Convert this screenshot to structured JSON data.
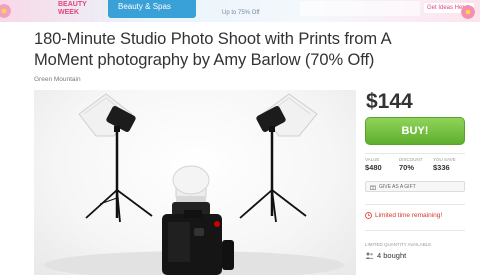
{
  "banner": {
    "left_text": "BEAUTY\nWEEK",
    "center_text": "Beauty & Spas",
    "center_sub": "Up to 75% Off",
    "right_text": "Get Ideas Here ›",
    "colors": {
      "accent": "#e0467c",
      "blue": "#3aa0d8"
    }
  },
  "deal": {
    "title": "180-Minute Studio Photo Shoot with Prints from A MoMent photography by Amy Barlow (70% Off)",
    "location": "Green Mountain",
    "photo_icon": "studio-camera-photo"
  },
  "sidebar": {
    "price": "$144",
    "buy_label": "BUY!",
    "stats": [
      {
        "label": "Value",
        "value": "$480"
      },
      {
        "label": "Discount",
        "value": "70%"
      },
      {
        "label": "You Save",
        "value": "$336"
      }
    ],
    "gift_label": "GIVE AS A GIFT",
    "limited_label": "Limited time remaining!",
    "quantity_label": "Limited quantity available",
    "bought_label": "4 bought",
    "colors": {
      "buy": "#6cbf3a",
      "price": "#333333",
      "alert": "#d9342b"
    }
  }
}
